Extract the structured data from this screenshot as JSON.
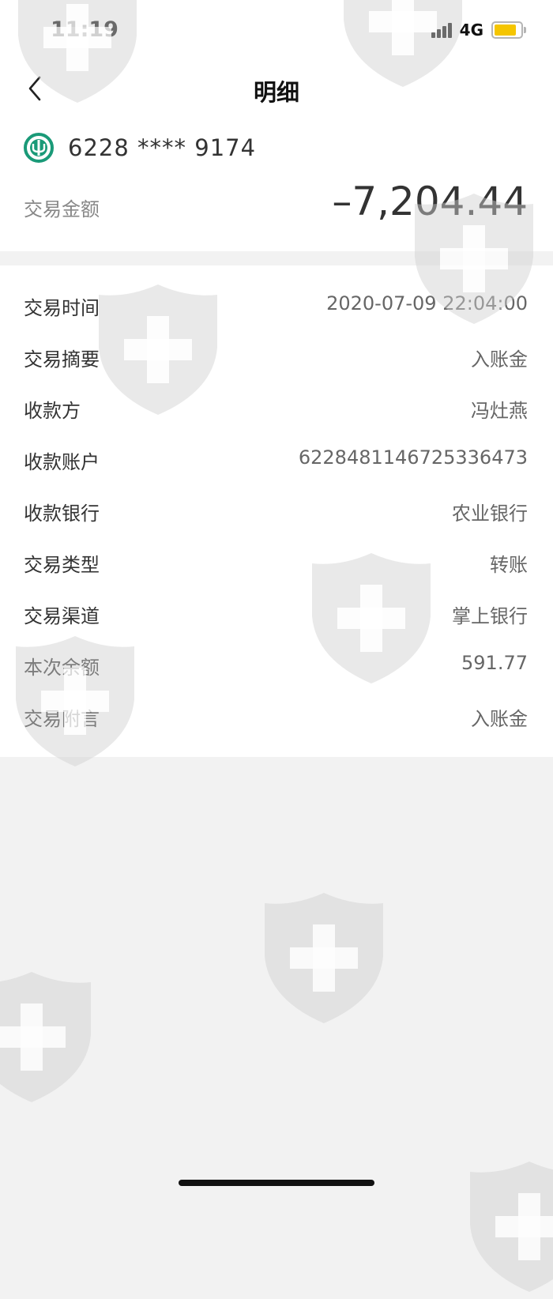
{
  "status_bar": {
    "time": "11:19",
    "network": "4G",
    "battery_level": 0.85,
    "battery_color": "#f5c500"
  },
  "nav": {
    "back_icon": "chevron-left-icon",
    "title": "明细"
  },
  "account": {
    "bank_logo_icon": "agricultural-bank-logo",
    "brand_color": "#1a9a78",
    "number": "6228 **** 9174"
  },
  "transaction": {
    "amount_label": "交易金额",
    "amount": "–7,204.44"
  },
  "details": [
    {
      "label": "交易时间",
      "value": "2020-07-09 22:04:00"
    },
    {
      "label": "交易摘要",
      "value": "入账金"
    },
    {
      "label": "收款方",
      "value": "冯灶燕"
    },
    {
      "label": "收款账户",
      "value": "6228481146725336473"
    },
    {
      "label": "收款银行",
      "value": "农业银行"
    },
    {
      "label": "交易类型",
      "value": "转账"
    },
    {
      "label": "交易渠道",
      "value": "掌上银行"
    },
    {
      "label": "本次余额",
      "value": "591.77"
    },
    {
      "label": "交易附言",
      "value": "入账金"
    }
  ],
  "watermark_icon": "shield-cross-icon"
}
